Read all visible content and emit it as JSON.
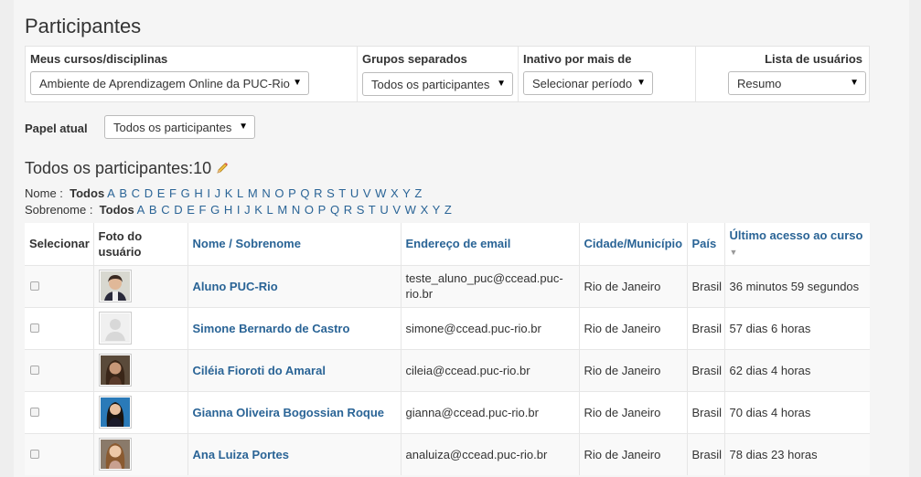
{
  "page_title": "Participantes",
  "filters": {
    "courses": {
      "label": "Meus cursos/disciplinas",
      "value": "Ambiente de Aprendizagem Online da PUC-Rio"
    },
    "groups": {
      "label": "Grupos separados",
      "value": "Todos os participantes"
    },
    "inactive": {
      "label": "Inativo por mais de",
      "value": "Selecionar período"
    },
    "userlist": {
      "label": "Lista de usuários",
      "value": "Resumo"
    }
  },
  "role": {
    "label": "Papel atual",
    "value": "Todos os participantes"
  },
  "participants_title": "Todos os participantes:10",
  "alpha_name": {
    "label": "Nome :",
    "all": "Todos",
    "letters": [
      "A",
      "B",
      "C",
      "D",
      "E",
      "F",
      "G",
      "H",
      "I",
      "J",
      "K",
      "L",
      "M",
      "N",
      "O",
      "P",
      "Q",
      "R",
      "S",
      "T",
      "U",
      "V",
      "W",
      "X",
      "Y",
      "Z"
    ]
  },
  "alpha_surname": {
    "label": "Sobrenome :",
    "all": "Todos",
    "letters": [
      "A",
      "B",
      "C",
      "D",
      "E",
      "F",
      "G",
      "H",
      "I",
      "J",
      "K",
      "L",
      "M",
      "N",
      "O",
      "P",
      "Q",
      "R",
      "S",
      "T",
      "U",
      "V",
      "W",
      "X",
      "Y",
      "Z"
    ]
  },
  "table": {
    "headers": {
      "select": "Selecionar",
      "photo": "Foto do usuário",
      "name": "Nome / Sobrenome",
      "email": "Endereço de email",
      "city": "Cidade/Município",
      "country": "País",
      "last_access": "Último acesso ao curso"
    },
    "rows": [
      {
        "name": "Aluno PUC-Rio",
        "email": "teste_aluno_puc@ccead.puc-rio.br",
        "city": "Rio de Janeiro",
        "country": "Brasil",
        "last_access": "36 minutos 59 segundos",
        "avatar": "avatar-short-dark-hair"
      },
      {
        "name": "Simone Bernardo de Castro",
        "email": "simone@ccead.puc-rio.br",
        "city": "Rio de Janeiro",
        "country": "Brasil",
        "last_access": "57 dias 6 horas",
        "avatar": "avatar-default"
      },
      {
        "name": "Ciléia Fioroti do Amaral",
        "email": "cileia@ccead.puc-rio.br",
        "city": "Rio de Janeiro",
        "country": "Brasil",
        "last_access": "62 dias 4 horas",
        "avatar": "avatar-long-hair"
      },
      {
        "name": "Gianna Oliveira Bogossian Roque",
        "email": "gianna@ccead.puc-rio.br",
        "city": "Rio de Janeiro",
        "country": "Brasil",
        "last_access": "70 dias 4 horas",
        "avatar": "avatar-blue-background"
      },
      {
        "name": "Ana Luiza Portes",
        "email": "analuiza@ccead.puc-rio.br",
        "city": "Rio de Janeiro",
        "country": "Brasil",
        "last_access": "78 dias 23 horas",
        "avatar": "avatar-light-hair"
      }
    ]
  },
  "colors": {
    "link": "#2a6496",
    "background": "#eeeeee",
    "panel": "#f5f5f5"
  }
}
